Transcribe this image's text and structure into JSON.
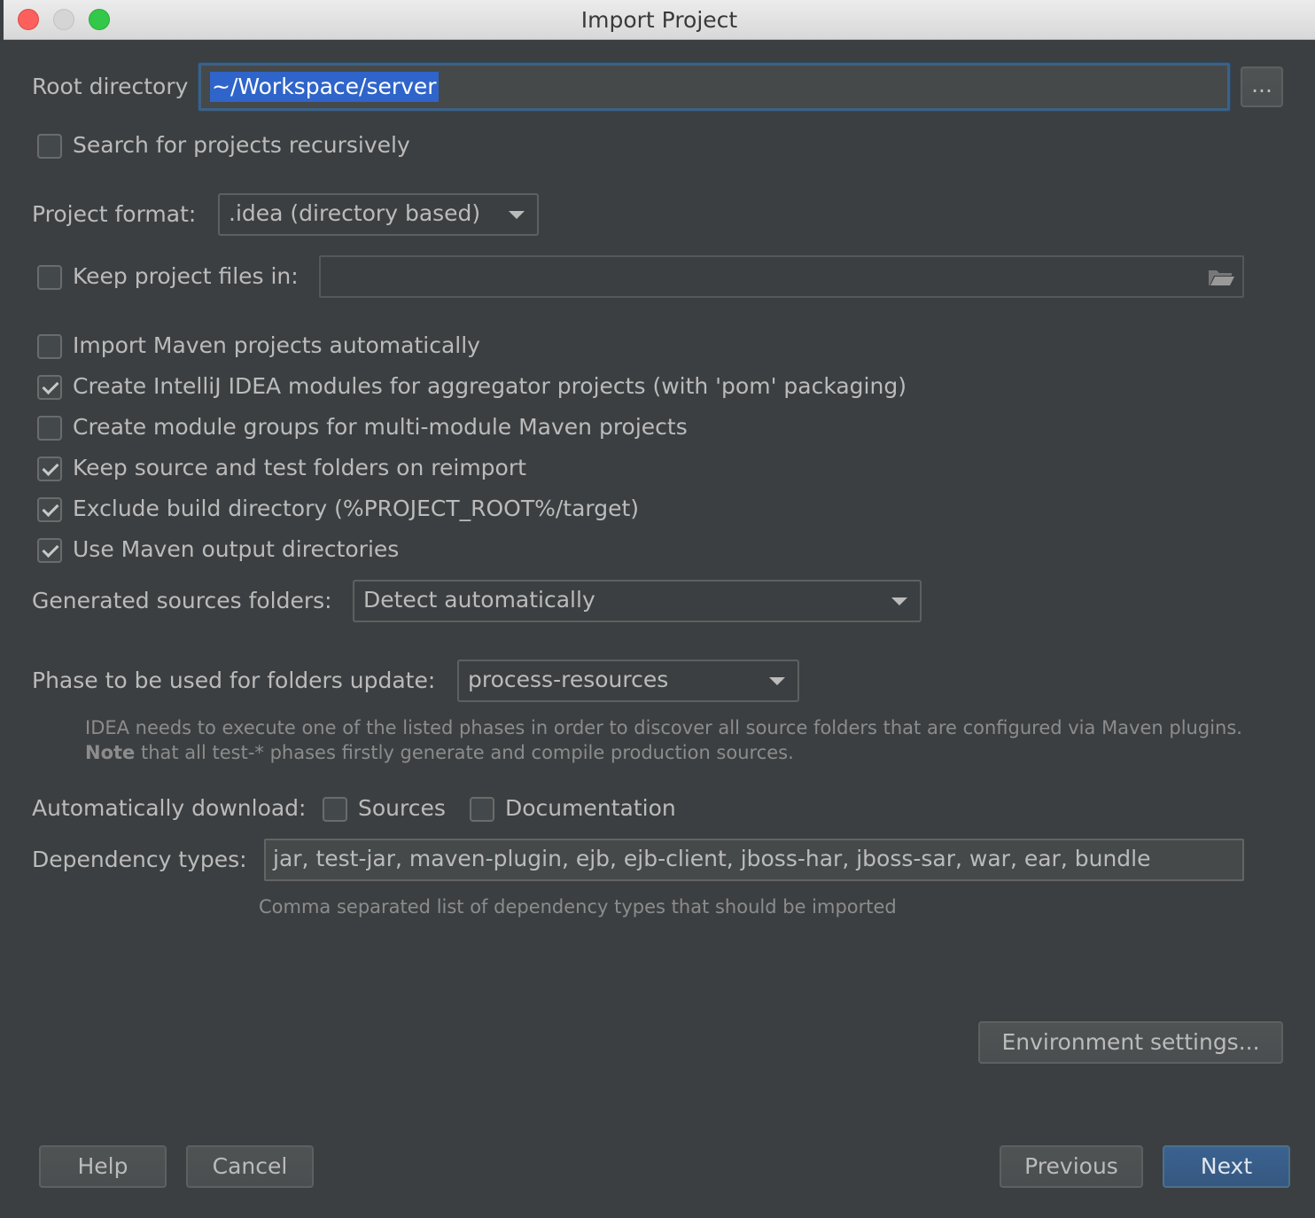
{
  "window": {
    "title": "Import Project"
  },
  "root_directory": {
    "label": "Root directory",
    "value": "~/Workspace/server",
    "browse_label": "..."
  },
  "search_recursive": {
    "label": "Search for projects recursively",
    "checked": false
  },
  "project_format": {
    "label": "Project format:",
    "value": ".idea (directory based)"
  },
  "keep_project_files": {
    "label": "Keep project files in:",
    "checked": false,
    "value": ""
  },
  "options": [
    {
      "label": "Import Maven projects automatically",
      "checked": false
    },
    {
      "label": "Create IntelliJ IDEA modules for aggregator projects (with 'pom' packaging)",
      "checked": true
    },
    {
      "label": "Create module groups for multi-module Maven projects",
      "checked": false
    },
    {
      "label": "Keep source and test folders on reimport",
      "checked": true
    },
    {
      "label": "Exclude build directory (%PROJECT_ROOT%/target)",
      "checked": true
    },
    {
      "label": "Use Maven output directories",
      "checked": true
    }
  ],
  "generated_sources": {
    "label": "Generated sources folders:",
    "value": "Detect automatically"
  },
  "phase": {
    "label": "Phase to be used for folders update:",
    "value": "process-resources",
    "hint_line1": "IDEA needs to execute one of the listed phases in order to discover all source folders that are configured via Maven plugins.",
    "hint_note_bold": "Note",
    "hint_line2_rest": " that all test-* phases firstly generate and compile production sources."
  },
  "auto_download": {
    "label": "Automatically download:",
    "sources": {
      "label": "Sources",
      "checked": false
    },
    "documentation": {
      "label": "Documentation",
      "checked": false
    }
  },
  "dependency_types": {
    "label": "Dependency types:",
    "value": "jar, test-jar, maven-plugin, ejb, ejb-client, jboss-har, jboss-sar, war, ear, bundle",
    "hint": "Comma separated list of dependency types that should be imported"
  },
  "buttons": {
    "environment": "Environment settings...",
    "help": "Help",
    "cancel": "Cancel",
    "previous": "Previous",
    "next": "Next"
  },
  "colors": {
    "background": "#3c3f41",
    "accent": "#365880",
    "selection": "#2f65ca"
  }
}
